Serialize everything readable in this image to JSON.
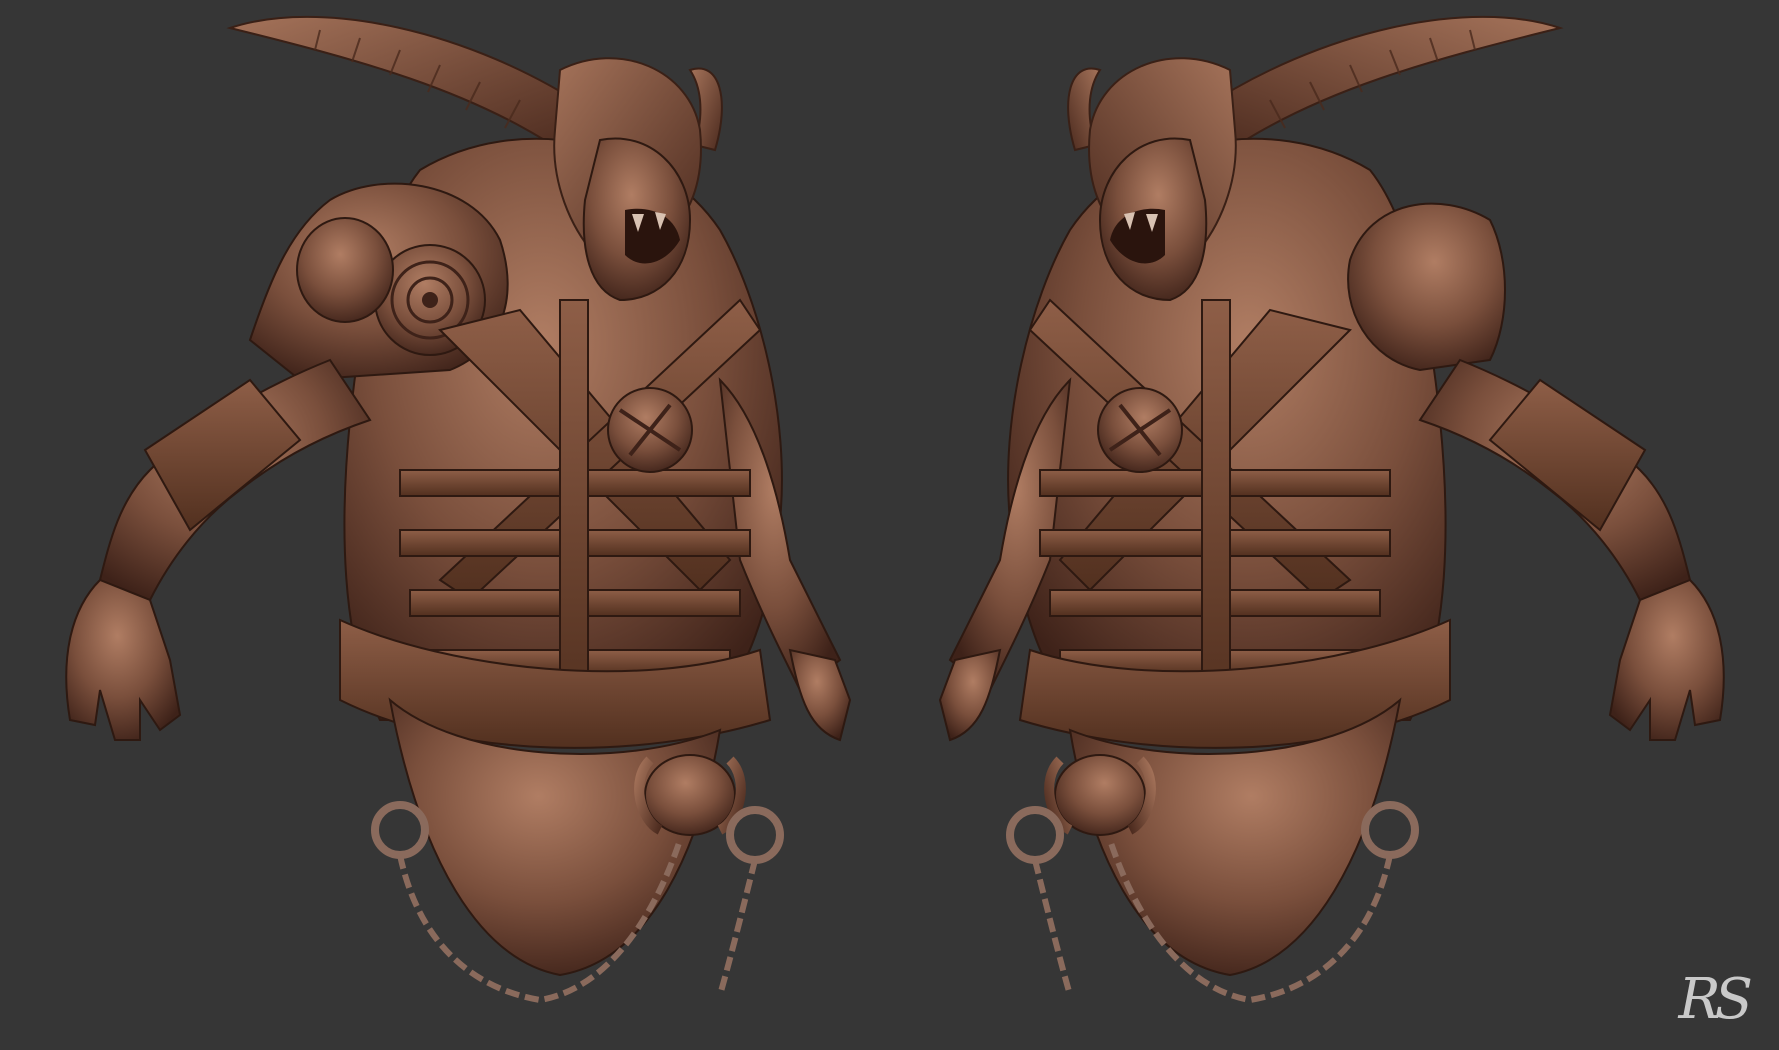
{
  "image": {
    "subject": "sculpt-render",
    "views": [
      "front-three-quarter-left",
      "front-three-quarter-right"
    ],
    "background_color": "#363636",
    "material_color": "#7a4f3c",
    "shadow_color": "#3e2219",
    "highlight_color": "#b07d63",
    "chain_color": "#8a6a5c"
  },
  "signature": {
    "text": "RS"
  }
}
